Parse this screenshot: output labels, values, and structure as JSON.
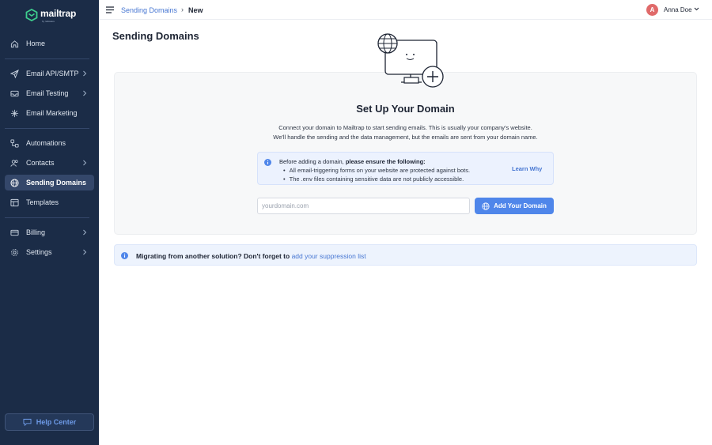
{
  "app": {
    "brand": "mailtrap",
    "brand_sub": "by railsware"
  },
  "sidebar": {
    "items": [
      {
        "label": "Home",
        "icon": "home-icon",
        "chevron": false
      },
      {
        "label": "Email API/SMTP",
        "icon": "send-icon",
        "chevron": true
      },
      {
        "label": "Email Testing",
        "icon": "inbox-icon",
        "chevron": true
      },
      {
        "label": "Email Marketing",
        "icon": "sparkle-icon",
        "chevron": false
      },
      {
        "label": "Automations",
        "icon": "automation-icon",
        "chevron": false
      },
      {
        "label": "Contacts",
        "icon": "contacts-icon",
        "chevron": true
      },
      {
        "label": "Sending Domains",
        "icon": "globe-icon",
        "chevron": false,
        "active": true
      },
      {
        "label": "Templates",
        "icon": "templates-icon",
        "chevron": false
      },
      {
        "label": "Billing",
        "icon": "billing-icon",
        "chevron": true
      },
      {
        "label": "Settings",
        "icon": "gear-icon",
        "chevron": true
      }
    ],
    "help_label": "Help Center"
  },
  "topbar": {
    "breadcrumb_link": "Sending Domains",
    "breadcrumb_sep": "›",
    "breadcrumb_current": "New",
    "avatar_initial": "A",
    "user_name": "Anna Doe"
  },
  "main": {
    "page_title": "Sending Domains",
    "setup_title": "Set Up Your Domain",
    "desc_line1": "Connect your domain to Mailtrap to start sending emails. This is usually your company's website.",
    "desc_line2": "We'll handle the sending and the data management, but the emails are sent from your domain name.",
    "alert": {
      "head_prefix": "Before adding a domain, ",
      "head_bold": "please ensure the following:",
      "items": [
        "All email-triggering forms on your website are protected against bots.",
        "The .env files containing sensitive data are not publicly accessible."
      ],
      "learn_label": "Learn Why"
    },
    "domain_input": {
      "placeholder": "yourdomain.com",
      "value": ""
    },
    "add_button_label": "Add Your Domain",
    "banner": {
      "text": "Migrating from another solution? Don't forget to ",
      "link": "add your suppression list"
    }
  },
  "colors": {
    "sidebar_bg": "#1b2c47",
    "sidebar_active": "#34476a",
    "accent": "#4f86ea",
    "link": "#4676d2",
    "avatar": "#e06a6a",
    "brand_green": "#3ecf8e"
  }
}
